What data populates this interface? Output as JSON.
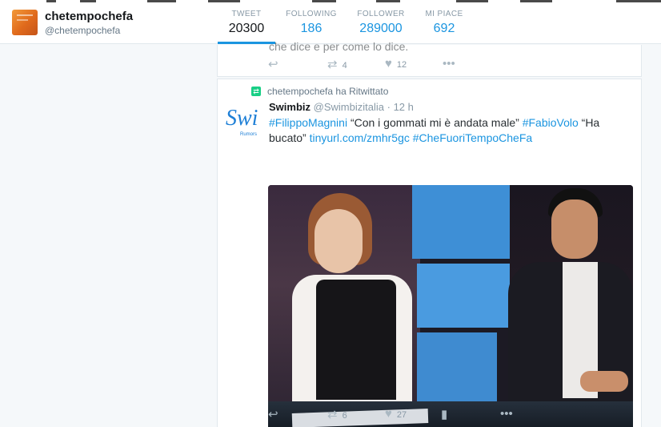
{
  "profile": {
    "name": "chetempochefa",
    "handle": "@chetempochefa"
  },
  "stats": [
    {
      "label": "TWEET",
      "value": "20300"
    },
    {
      "label": "FOLLOWING",
      "value": "186"
    },
    {
      "label": "FOLLOWER",
      "value": "289000"
    },
    {
      "label": "MI PIACE",
      "value": "692"
    }
  ],
  "previous_tweet": {
    "text_fragment": "che dice e per come lo dice.",
    "reply_icon": "reply-icon",
    "retweet_count": "4",
    "like_count": "12"
  },
  "tweet": {
    "retweet_context": "chetempochefa ha Ritwittato",
    "avatar_text": "Swi",
    "avatar_subtext": "Rumors",
    "author_name": "Swimbiz",
    "author_handle": "@Swimbizitalia",
    "separator": "·",
    "time": "12 h",
    "text_parts": {
      "tag1": "#FilippoMagnini",
      "quote": " “Con i gommati mi è andata male” ",
      "tag2": "#FabioVolo",
      "quote2": " “Ha bucato”  ",
      "link": "tinyurl.com/zmhr5gc",
      "space": " ",
      "tag3": "#CheFuoriTempoCheFa"
    },
    "retweet_count": "6",
    "like_count": "27"
  },
  "icons": {
    "reply": "↩",
    "retweet": "⇄",
    "like": "♥",
    "more": "•••",
    "analytics": "▮"
  }
}
